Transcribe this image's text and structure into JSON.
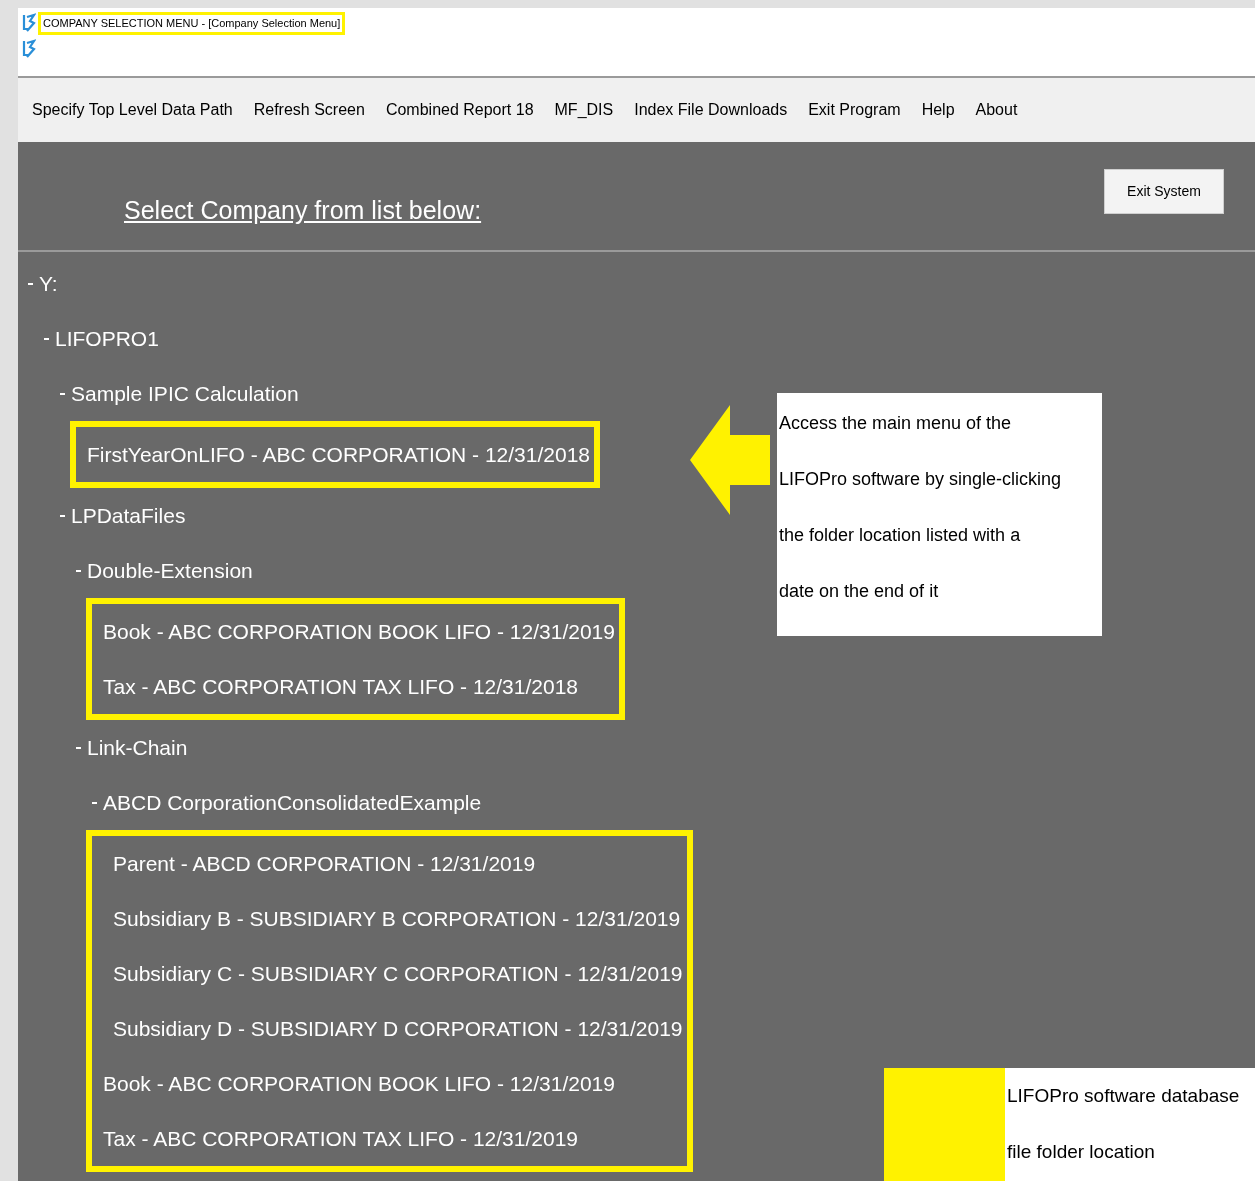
{
  "window": {
    "title": "COMPANY SELECTION MENU - [Company Selection Menu]",
    "title_highlighted": true
  },
  "menu": [
    "Specify Top Level Data Path",
    "Refresh Screen",
    "Combined Report 18",
    "MF_DIS",
    "Index File Downloads",
    "Exit Program",
    "Help",
    "About"
  ],
  "heading": "Select Company from list below:",
  "exit_button": "Exit System",
  "tree": [
    {
      "label": "Y:",
      "expanded": true,
      "children": [
        {
          "label": "LIFOPRO1",
          "expanded": true,
          "children": [
            {
              "label": "Sample IPIC Calculation",
              "expanded": true,
              "children": [
                {
                  "label": "FirstYearOnLIFO - ABC CORPORATION - 12/31/2018",
                  "highlighted": true
                }
              ]
            },
            {
              "label": "LPDataFiles",
              "expanded": true,
              "children": [
                {
                  "label": "Double-Extension",
                  "expanded": true,
                  "children": [
                    {
                      "label": "Book - ABC CORPORATION BOOK LIFO - 12/31/2019",
                      "highlighted": true
                    },
                    {
                      "label": "Tax - ABC CORPORATION TAX LIFO - 12/31/2018",
                      "highlighted": true
                    }
                  ]
                },
                {
                  "label": "Link-Chain",
                  "expanded": true,
                  "children": [
                    {
                      "label": "ABCD CorporationConsolidatedExample",
                      "expanded": true,
                      "children": [
                        {
                          "label": "Parent - ABCD CORPORATION - 12/31/2019",
                          "highlighted": true
                        },
                        {
                          "label": "Subsidiary B - SUBSIDIARY B CORPORATION - 12/31/2019",
                          "highlighted": true
                        },
                        {
                          "label": "Subsidiary C - SUBSIDIARY C CORPORATION - 12/31/2019",
                          "highlighted": true
                        },
                        {
                          "label": "Subsidiary D - SUBSIDIARY D CORPORATION - 12/31/2019",
                          "highlighted": true
                        }
                      ]
                    },
                    {
                      "label": "Book - ABC CORPORATION BOOK LIFO - 12/31/2019",
                      "highlighted": true
                    },
                    {
                      "label": "Tax - ABC CORPORATION TAX LIFO - 12/31/2019",
                      "highlighted": true
                    }
                  ]
                }
              ]
            }
          ]
        }
      ]
    }
  ],
  "callout": {
    "lines": [
      "Access the main menu of the",
      "LIFOPro software by single-clicking",
      "the folder location listed with a",
      "date on the end of it"
    ]
  },
  "legend": {
    "color": "#fff200",
    "lines": [
      "LIFOPro software database",
      "file folder location"
    ]
  }
}
